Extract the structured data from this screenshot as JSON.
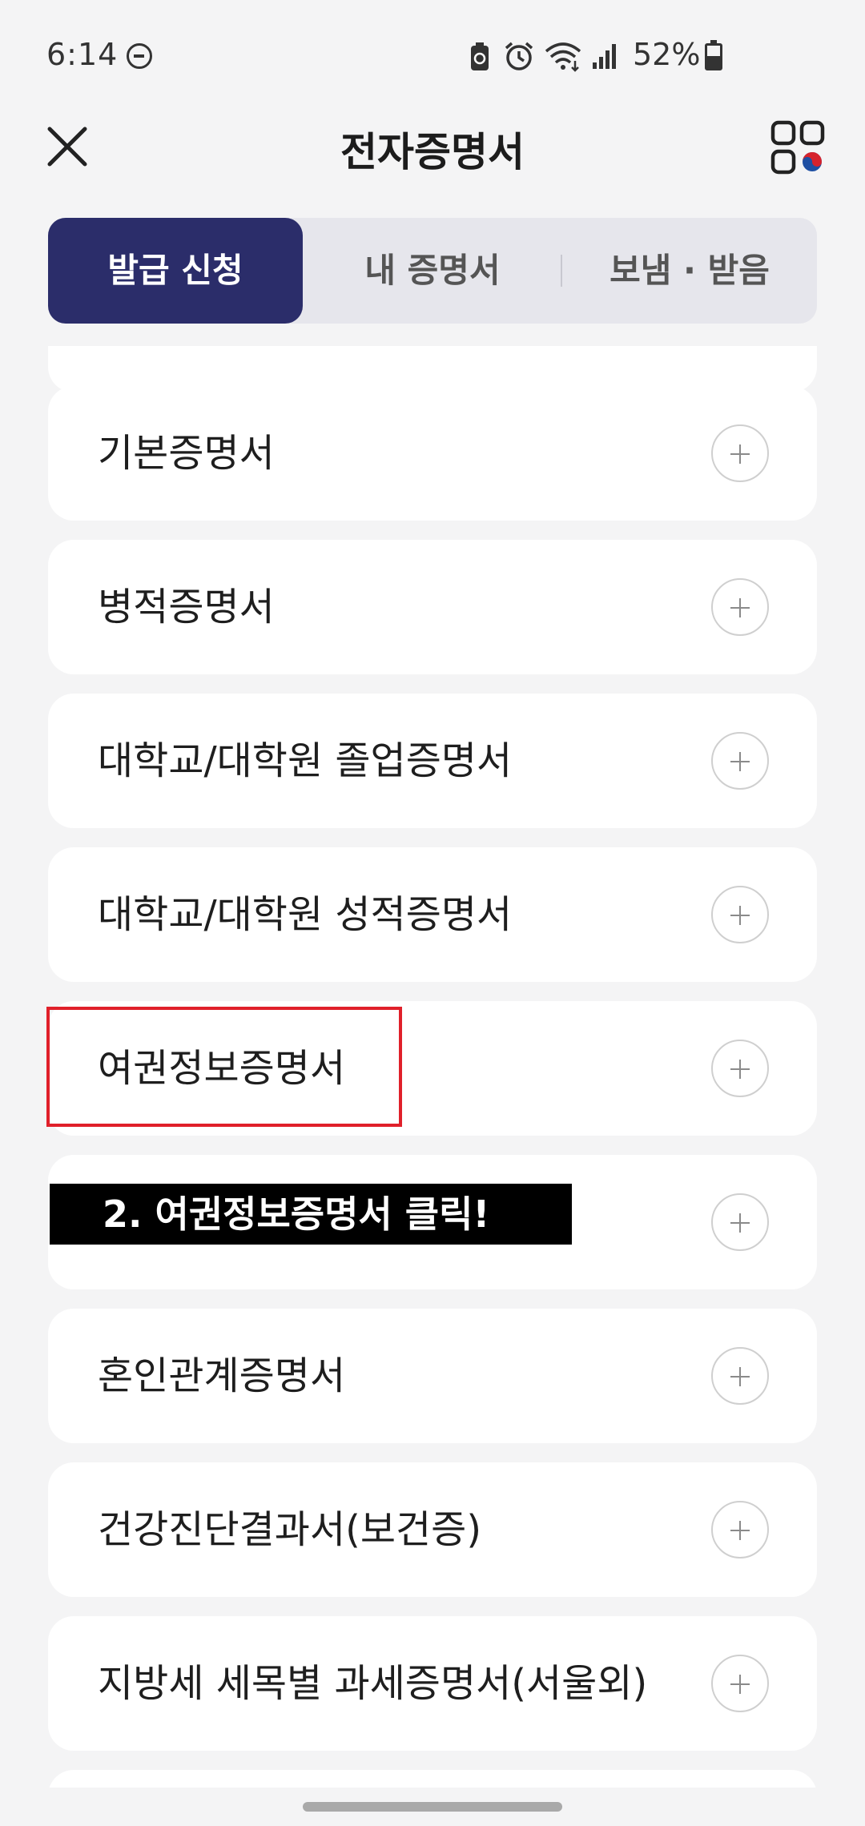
{
  "status_bar": {
    "time": "6:14",
    "battery": "52%",
    "icons": [
      "dnd-icon",
      "battery-saver-icon",
      "alarm-icon",
      "wifi-icon",
      "signal-icon",
      "battery-icon"
    ]
  },
  "header": {
    "title": "전자증명서",
    "close_icon": "close-icon",
    "menu_icon": "grid-menu-icon"
  },
  "tabs": [
    {
      "label": "발급 신청",
      "active": true
    },
    {
      "label": "내 증명서",
      "active": false
    },
    {
      "label": "보냄 · 받음",
      "active": false
    }
  ],
  "certificates": [
    {
      "label": "기본증명서"
    },
    {
      "label": "병적증명서"
    },
    {
      "label": "대학교/대학원 졸업증명서"
    },
    {
      "label": "대학교/대학원 성적증명서"
    },
    {
      "label": "여권정보증명서"
    },
    {
      "label": ""
    },
    {
      "label": "혼인관계증명서"
    },
    {
      "label": "건강진단결과서(보건증)"
    },
    {
      "label": "지방세 세목별 과세증명서(서울외)"
    }
  ],
  "annotation": {
    "text": "2. 여권정보증명서 클릭!",
    "highlight_color": "#e0202a"
  },
  "colors": {
    "accent": "#2b2d6a",
    "background": "#f4f4f5"
  }
}
